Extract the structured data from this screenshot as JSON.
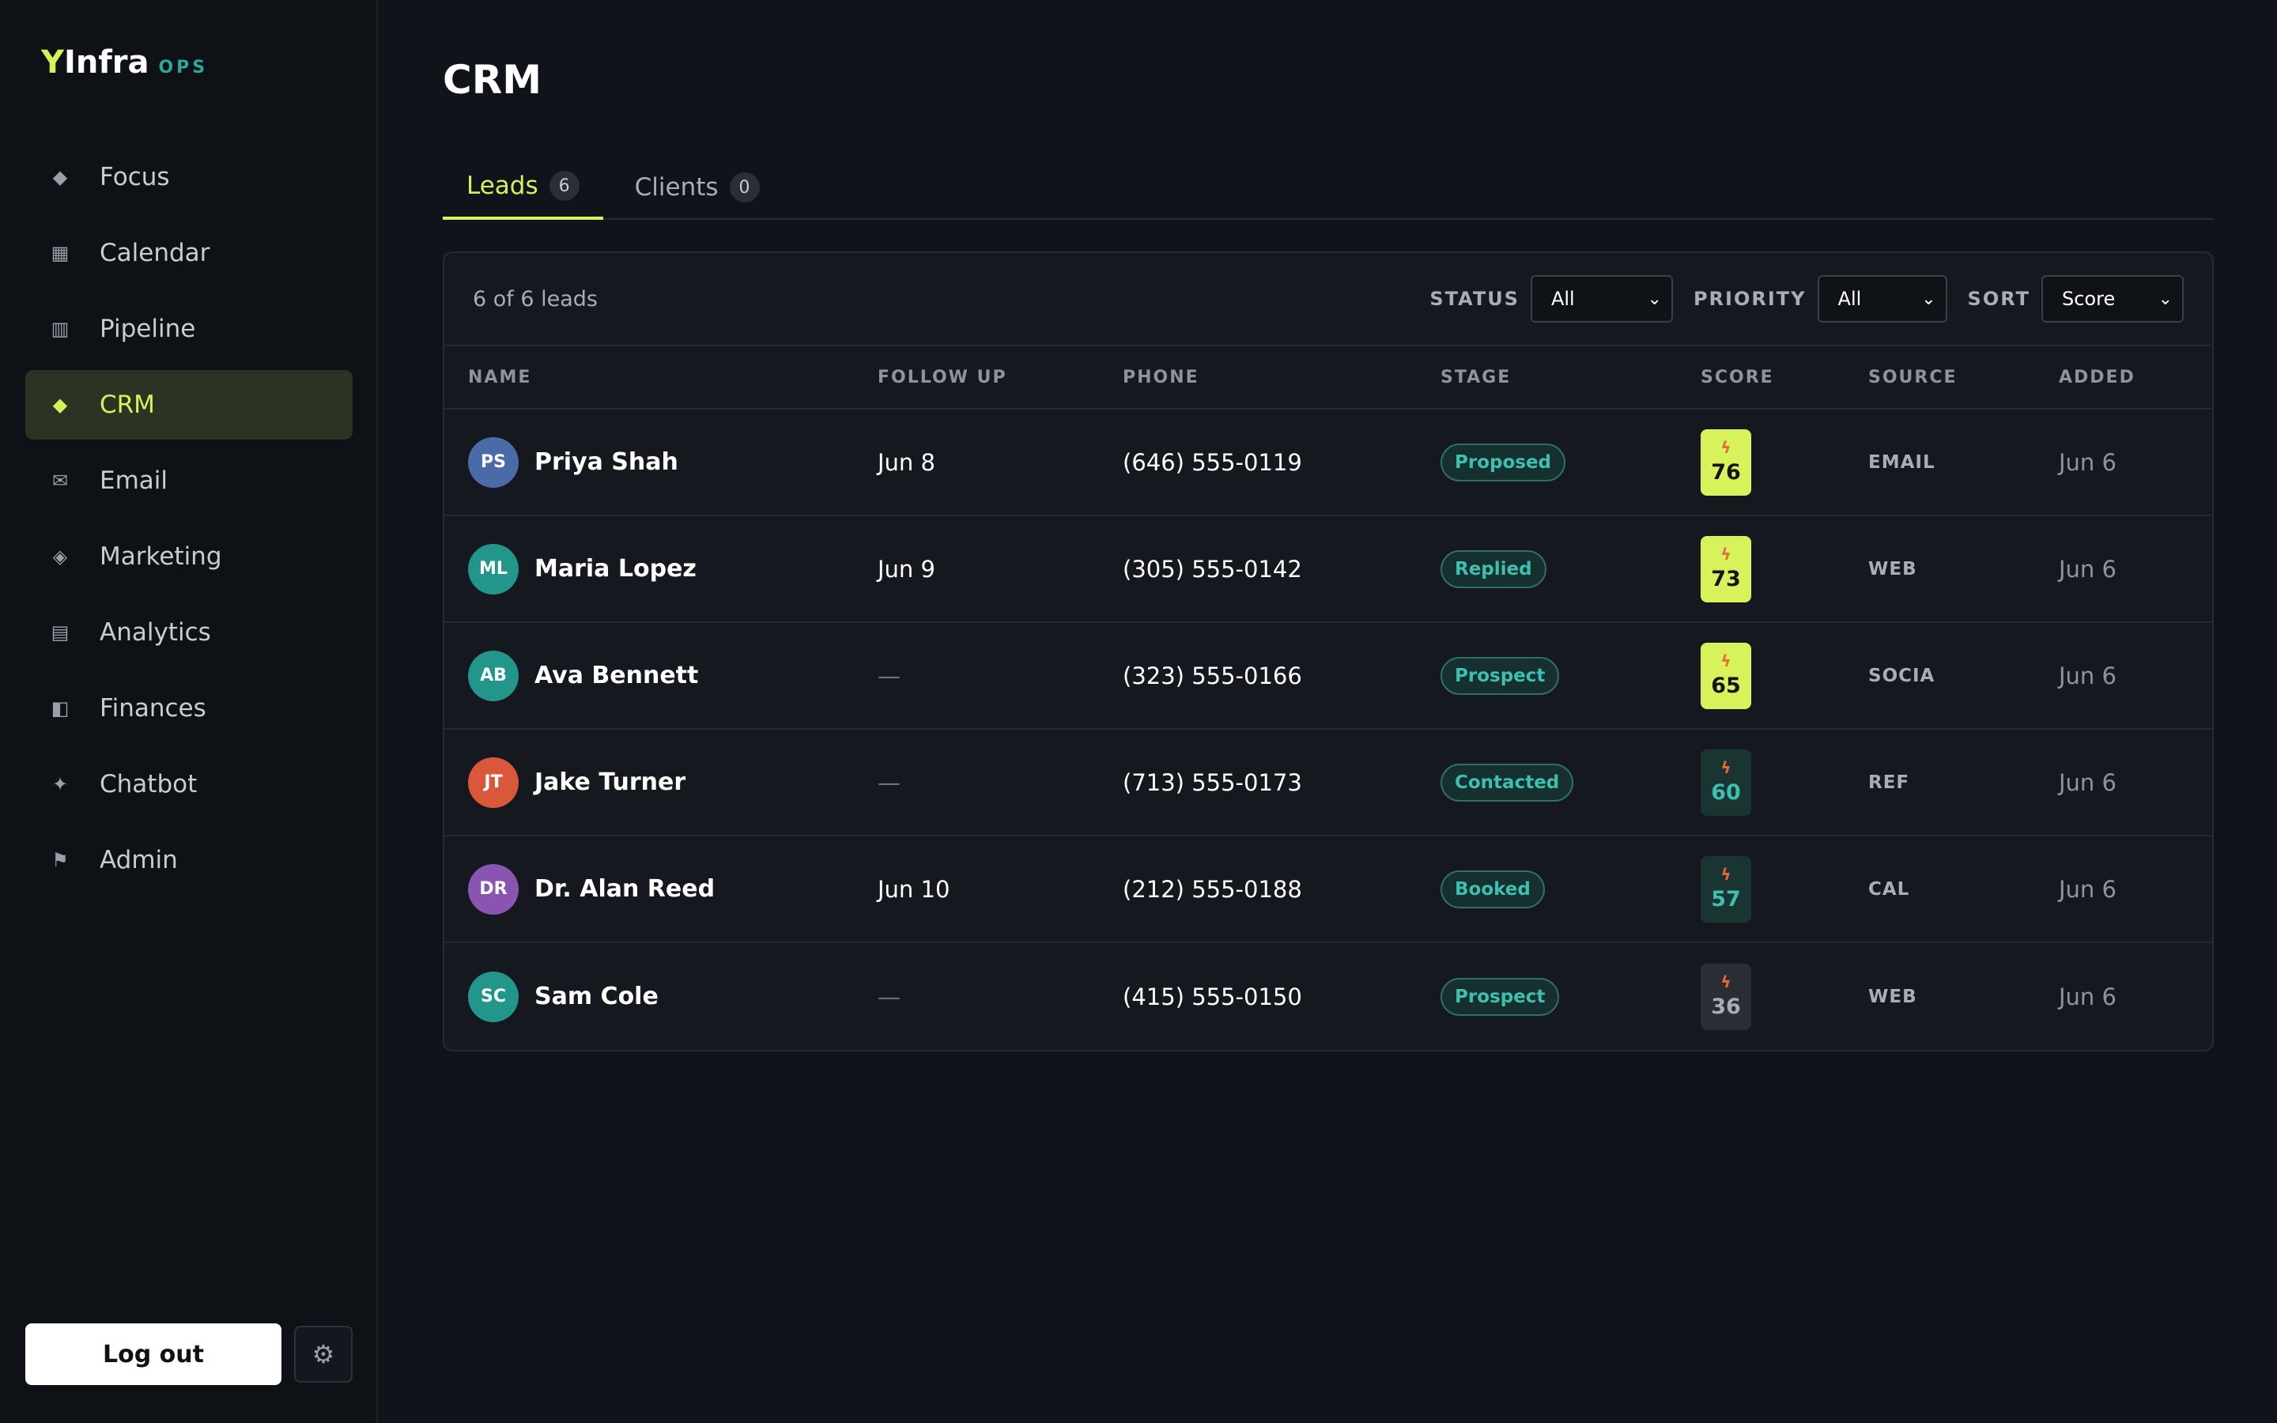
{
  "brand": {
    "y": "Y",
    "name": "Infra",
    "tag": "OPS"
  },
  "nav": [
    {
      "label": "Focus",
      "icon": "diamond-icon",
      "glyph": "◆"
    },
    {
      "label": "Calendar",
      "icon": "calendar-icon",
      "glyph": "▦"
    },
    {
      "label": "Pipeline",
      "icon": "pipeline-icon",
      "glyph": "▥"
    },
    {
      "label": "CRM",
      "icon": "crm-icon",
      "glyph": "◆"
    },
    {
      "label": "Email",
      "icon": "mail-icon",
      "glyph": "✉"
    },
    {
      "label": "Marketing",
      "icon": "marketing-icon",
      "glyph": "◈"
    },
    {
      "label": "Analytics",
      "icon": "analytics-icon",
      "glyph": "▤"
    },
    {
      "label": "Finances",
      "icon": "finances-icon",
      "glyph": "◧"
    },
    {
      "label": "Chatbot",
      "icon": "sparkle-icon",
      "glyph": "✦"
    },
    {
      "label": "Admin",
      "icon": "flag-icon",
      "glyph": "⚑"
    }
  ],
  "active_nav": "CRM",
  "footer": {
    "logout_label": "Log out",
    "settings_glyph": "⚙"
  },
  "page": {
    "title": "CRM"
  },
  "tabs": [
    {
      "label": "Leads",
      "count": "6"
    },
    {
      "label": "Clients",
      "count": "0"
    }
  ],
  "toolbar": {
    "count_text": "6 of 6 leads",
    "status_label": "STATUS",
    "status_value": "All",
    "priority_label": "PRIORITY",
    "priority_value": "All",
    "sort_label": "SORT",
    "sort_value": "Score"
  },
  "columns": [
    "NAME",
    "FOLLOW UP",
    "PHONE",
    "STAGE",
    "SCORE",
    "SOURCE",
    "ADDED"
  ],
  "leads": [
    {
      "initials": "PS",
      "avatar_color": "#4a6aa8",
      "name": "Priya Shah",
      "follow_up": "Jun 8",
      "phone": "(646) 555-0119",
      "stage": "Proposed",
      "score": "76",
      "tier": "hot",
      "source": "EMAIL",
      "added": "Jun 6"
    },
    {
      "initials": "ML",
      "avatar_color": "#23968c",
      "name": "Maria Lopez",
      "follow_up": "Jun 9",
      "phone": "(305) 555-0142",
      "stage": "Replied",
      "score": "73",
      "tier": "hot",
      "source": "WEB",
      "added": "Jun 6"
    },
    {
      "initials": "AB",
      "avatar_color": "#23968c",
      "name": "Ava Bennett",
      "follow_up": "—",
      "phone": "(323) 555-0166",
      "stage": "Prospect",
      "score": "65",
      "tier": "hot",
      "source": "SOCIA",
      "added": "Jun 6"
    },
    {
      "initials": "JT",
      "avatar_color": "#d9583a",
      "name": "Jake Turner",
      "follow_up": "—",
      "phone": "(713) 555-0173",
      "stage": "Contacted",
      "score": "60",
      "tier": "warm",
      "source": "REF",
      "added": "Jun 6"
    },
    {
      "initials": "DR",
      "avatar_color": "#8a55b0",
      "name": "Dr. Alan Reed",
      "follow_up": "Jun 10",
      "phone": "(212) 555-0188",
      "stage": "Booked",
      "score": "57",
      "tier": "warm",
      "source": "CAL",
      "added": "Jun 6"
    },
    {
      "initials": "SC",
      "avatar_color": "#23968c",
      "name": "Sam Cole",
      "follow_up": "—",
      "phone": "(415) 555-0150",
      "stage": "Prospect",
      "score": "36",
      "tier": "cool",
      "source": "WEB",
      "added": "Jun 6"
    }
  ],
  "icons": {
    "bolt": "ϟ",
    "chevron": "⌄"
  }
}
